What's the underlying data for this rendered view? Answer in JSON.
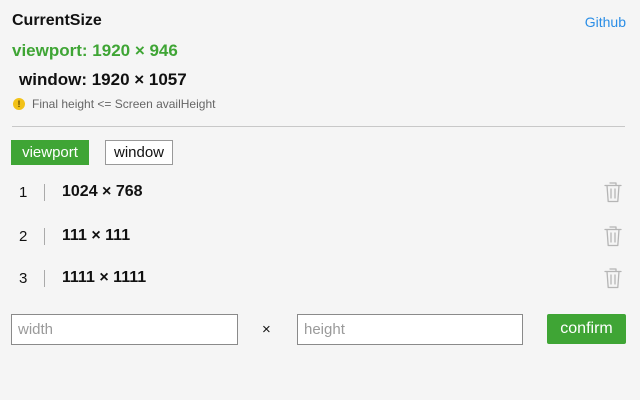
{
  "header": {
    "title": "CurrentSize",
    "github_link": "Github"
  },
  "current": {
    "viewport_text": "viewport: 1920 × 946",
    "window_text": "window: 1920 × 1057",
    "note": "Final height <= Screen availHeight",
    "note_icon": "warning-icon"
  },
  "mode_tabs": {
    "active": "viewport",
    "items": [
      "viewport",
      "window"
    ]
  },
  "sizes": [
    {
      "index": "1",
      "size": "1024 × 768"
    },
    {
      "index": "2",
      "size": "111 × 111"
    },
    {
      "index": "3",
      "size": "1111 × 1111"
    }
  ],
  "form": {
    "width_placeholder": "width",
    "height_placeholder": "height",
    "times_symbol": "×",
    "confirm_label": "confirm"
  },
  "colors": {
    "accent_green": "#3fa535",
    "link_blue": "#2b8ee6",
    "warning_yellow": "#f2c218"
  }
}
